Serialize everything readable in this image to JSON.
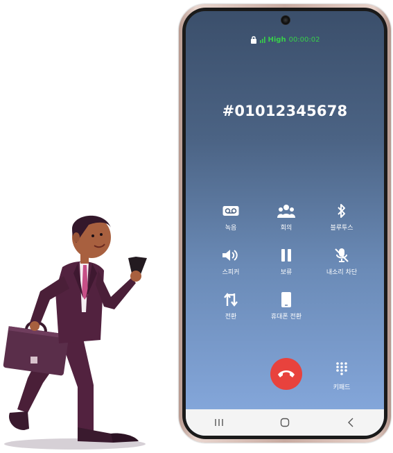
{
  "status_bar": {
    "network": "High",
    "call_timer": "00:00:02",
    "icons": [
      "lock-icon",
      "signal-icon"
    ],
    "color": "#38d04a"
  },
  "call": {
    "callee": "#01012345678"
  },
  "controls": [
    {
      "label": "녹음",
      "icon": "voicemail-icon"
    },
    {
      "label": "회의",
      "icon": "conference-icon"
    },
    {
      "label": "블루투스",
      "icon": "bluetooth-icon"
    },
    {
      "label": "스피커",
      "icon": "speaker-icon"
    },
    {
      "label": "보류",
      "icon": "pause-icon"
    },
    {
      "label": "내소리 차단",
      "icon": "mute-mic-icon"
    },
    {
      "label": "전환",
      "icon": "swap-icon"
    },
    {
      "label": "휴대폰 전환",
      "icon": "phone-icon"
    }
  ],
  "end_call": {
    "icon": "end-call-icon",
    "color": "#e8423d"
  },
  "keypad": {
    "label": "키패드",
    "icon": "keypad-icon"
  },
  "navbar": {
    "items": [
      "recent-apps-icon",
      "home-icon",
      "back-icon"
    ]
  }
}
